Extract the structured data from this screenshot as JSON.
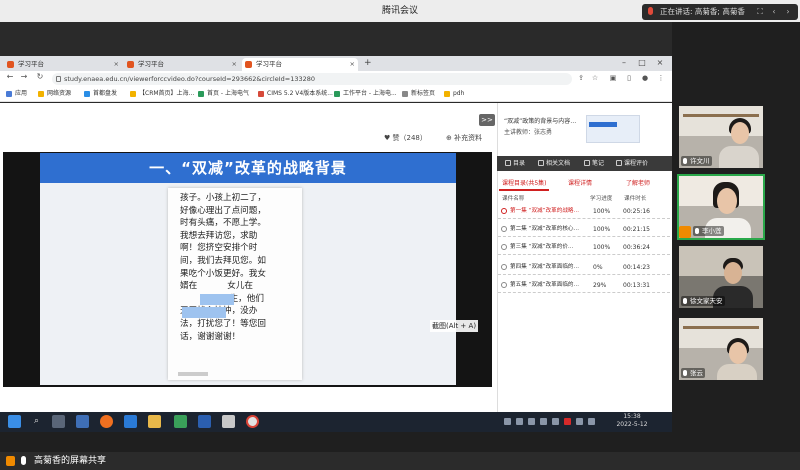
{
  "meeting": {
    "title": "腾讯会议",
    "speaker": "正在讲话: 高菊香; 高菊香",
    "ctrl_fullscreen": "⛶",
    "ctrl_prev": "‹",
    "ctrl_next": "›"
  },
  "browser": {
    "tabs": [
      {
        "label": "学习平台",
        "close": "×"
      },
      {
        "label": "学习平台",
        "close": "×"
      },
      {
        "label": "学习平台",
        "close": "×"
      }
    ],
    "new_tab": "+",
    "url": "study.enaea.edu.cn/viewerforccvideo.do?courseId=293662&circleId=133280",
    "bookmarks": [
      "应用",
      "网络资源",
      "首都盘发",
      "【CRM首页】上海...",
      "首页 - 上海电气",
      "CIMS 5.2 V4版本系统...",
      "工作平台 - 上海电...",
      "新标签页",
      "pdh"
    ]
  },
  "page": {
    "like": "♥ 赞（248）",
    "favorite": "⊕ 补充资料",
    "collapse": ">>",
    "slide_heading": "一、“双减”改革的战略背景",
    "card_lines": [
      "孩子。小孩上初二了，",
      "好像心理出了点问题，",
      "时有头痛，不愿上学。",
      "我想去拜访您，求助",
      "啊！您挤空安排个时",
      "间，我们去拜见您。如",
      "果吃个小饭更好。我女",
      "婿在           女儿在",
      "               医生，他们",
      "天天忧心忡忡，没办",
      "法，打扰您了！等您回",
      "话，谢谢谢谢！"
    ],
    "shortcut_tip": "截图(Alt + A)",
    "course_title": "“双减”政策的背景与内容…",
    "course_teacher": "主讲教师：张志勇",
    "right_tabs": [
      "目录",
      "相关文档",
      "笔记",
      "课程评价"
    ],
    "sub_tabs": [
      "课程目录(共5集)",
      "课程详情",
      "了解老师"
    ],
    "columns": {
      "name": "课件名称",
      "progress": "学习进度",
      "duration": "课件时长"
    },
    "lessons": [
      {
        "name": "第一集 “双减”改革的战略…",
        "progress": "100%",
        "duration": "00:25:16",
        "active": true
      },
      {
        "name": "第二集 “双减”改革的核心…",
        "progress": "100%",
        "duration": "00:21:15",
        "active": false
      },
      {
        "name": "第三集 “双减”改革的价…",
        "progress": "100%",
        "duration": "00:36:24",
        "active": false
      },
      {
        "name": "第四集 “双减”改革面临的…",
        "progress": "0%",
        "duration": "00:14:23",
        "active": false
      },
      {
        "name": "第五集 “双减”改革面临的…",
        "progress": "29%",
        "duration": "00:13:31",
        "active": false
      }
    ]
  },
  "taskbar": {
    "time": "15:38",
    "date": "2022-5-12"
  },
  "participants": [
    {
      "name": "许文川"
    },
    {
      "name": "李小莲"
    },
    {
      "name": "徐文家天安"
    },
    {
      "name": "张云"
    }
  ],
  "share_bar": {
    "text": "高菊香的屏幕共享"
  }
}
